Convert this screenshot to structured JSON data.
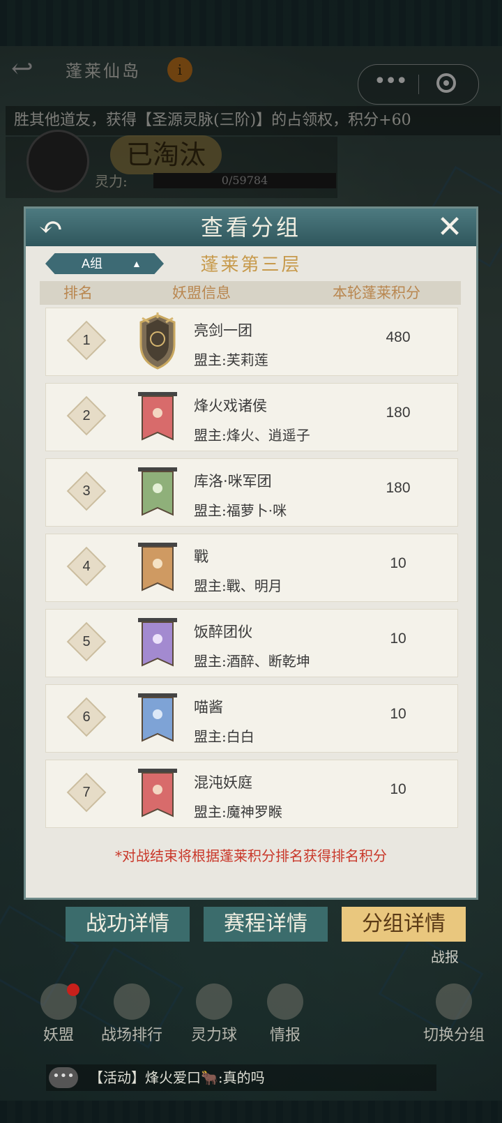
{
  "header": {
    "title": "蓬莱仙岛",
    "info_icon": "i"
  },
  "ticker": "胜其他道友，获得【圣源灵脉(三阶)】的占领权，积分+60",
  "status": {
    "eliminated": "已淘汰",
    "power_label": "灵力:",
    "power_value": "0/59784"
  },
  "modal": {
    "title": "查看分组",
    "group_select": "A组",
    "layer_title": "蓬莱第三层",
    "columns": {
      "rank": "排名",
      "info": "妖盟信息",
      "score": "本轮蓬莱积分"
    },
    "rows": [
      {
        "rank": "1",
        "name": "亮剑一团",
        "leader": "盟主:芙莉莲",
        "score": "480",
        "emblem_color": "#8a7a60"
      },
      {
        "rank": "2",
        "name": "烽火戏诸侯",
        "leader": "盟主:烽火、逍遥子",
        "score": "180",
        "emblem_color": "#d86b6b"
      },
      {
        "rank": "3",
        "name": "库洛·咪军团",
        "leader": "盟主:福萝卜·咪",
        "score": "180",
        "emblem_color": "#8fb07a"
      },
      {
        "rank": "4",
        "name": "戰",
        "leader": "盟主:戰、明月",
        "score": "10",
        "emblem_color": "#cf9a62"
      },
      {
        "rank": "5",
        "name": "饭醉团伙",
        "leader": "盟主:酒醉、断乾坤",
        "score": "10",
        "emblem_color": "#a38ad0"
      },
      {
        "rank": "6",
        "name": "喵酱",
        "leader": "盟主:白白",
        "score": "10",
        "emblem_color": "#7ea3d6"
      },
      {
        "rank": "7",
        "name": "混沌妖庭",
        "leader": "盟主:魔神罗睺",
        "score": "10",
        "emblem_color": "#d86b6b"
      }
    ],
    "footnote": "*对战结束将根据蓬莱积分排名获得排名积分"
  },
  "tabs": {
    "battle": "战功详情",
    "schedule": "赛程详情",
    "group": "分组详情"
  },
  "report": "战报",
  "nav": {
    "alliance": "妖盟",
    "ranking": "战场排行",
    "orb": "灵力球",
    "intel": "情报",
    "switch": "切换分组"
  },
  "chat": {
    "text": "【活动】烽火爱口🐂:真的吗"
  }
}
